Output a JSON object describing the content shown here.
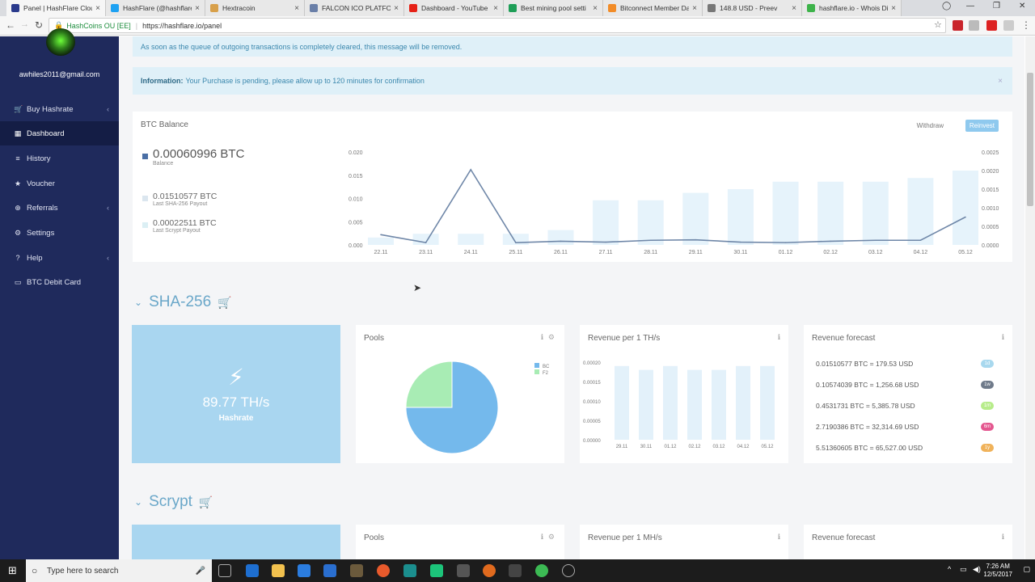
{
  "browser": {
    "tabs": [
      {
        "title": "Panel | HashFlare Clou",
        "color": "#2a3a8c"
      },
      {
        "title": "HashFlare (@hashflare",
        "color": "#1da1f2"
      },
      {
        "title": "Hextracoin",
        "color": "#d8a04a"
      },
      {
        "title": "FALCON ICO PLATFOR",
        "color": "#6a7fa8"
      },
      {
        "title": "Dashboard - YouTube",
        "color": "#e62117"
      },
      {
        "title": "Best mining pool setti",
        "color": "#1e9e57"
      },
      {
        "title": "Bitconnect Member Da",
        "color": "#f28c28"
      },
      {
        "title": "148.8 USD - Preev",
        "color": "#777777"
      },
      {
        "title": "hashflare.io - Whois Di",
        "color": "#3db34a"
      }
    ],
    "site_label": "HashCoins OU [EE]",
    "url": "https://hashflare.io/panel"
  },
  "sidebar": {
    "email": "awhiles2011@gmail.com",
    "items": [
      {
        "label": "Buy Hashrate",
        "icon": "cart-icon",
        "glyph": "🛒",
        "caret": "‹"
      },
      {
        "label": "Dashboard",
        "icon": "dashboard-icon",
        "glyph": "▦",
        "caret": ""
      },
      {
        "label": "History",
        "icon": "history-icon",
        "glyph": "≡",
        "caret": ""
      },
      {
        "label": "Voucher",
        "icon": "star-icon",
        "glyph": "★",
        "caret": ""
      },
      {
        "label": "Referrals",
        "icon": "referrals-icon",
        "glyph": "⊕",
        "caret": "‹"
      },
      {
        "label": "Settings",
        "icon": "gear-icon",
        "glyph": "⚙",
        "caret": ""
      },
      {
        "label": "Help",
        "icon": "help-icon",
        "glyph": "?",
        "caret": "‹"
      },
      {
        "label": "BTC Debit Card",
        "icon": "card-icon",
        "glyph": "▭",
        "caret": ""
      }
    ]
  },
  "alerts": {
    "queue_msg": "As soon as the queue of outgoing transactions is completely cleared, this message will be removed.",
    "info_label": "Information:",
    "info_msg": "Your Purchase is pending, please allow up to 120 minutes for confirmation"
  },
  "btc_balance": {
    "title": "BTC Balance",
    "withdraw": "Withdraw",
    "reinvest": "Reinvest",
    "balance": "0.00060996 BTC",
    "balance_label": "Balance",
    "sha_payout": "0.01510577 BTC",
    "sha_payout_label": "Last SHA-256 Payout",
    "scrypt_payout": "0.00022511 BTC",
    "scrypt_payout_label": "Last Scrypt Payout"
  },
  "sha256": {
    "heading": "SHA-256",
    "hashrate": "89.77 TH/s",
    "hashrate_label": "Hashrate",
    "pools_title": "Pools",
    "revenue_title": "Revenue per 1 TH/s",
    "forecast_title": "Revenue forecast",
    "forecast": [
      {
        "text": "0.01510577 BTC = 179.53 USD",
        "badge": "1d",
        "color": "#a8d8ee"
      },
      {
        "text": "0.10574039 BTC = 1,256.68 USD",
        "badge": "1w",
        "color": "#6f7a8a"
      },
      {
        "text": "0.4531731 BTC = 5,385.78 USD",
        "badge": "1m",
        "color": "#b7ec8a"
      },
      {
        "text": "2.7190386 BTC = 32,314.69 USD",
        "badge": "6m",
        "color": "#e4578f"
      },
      {
        "text": "5.51360605 BTC = 65,527.00 USD",
        "badge": "1y",
        "color": "#f0b25a"
      }
    ]
  },
  "scrypt": {
    "heading": "Scrypt",
    "pools_title": "Pools",
    "revenue_title": "Revenue per 1 MH/s",
    "forecast_title": "Revenue forecast"
  },
  "taskbar": {
    "search_placeholder": "Type here to search",
    "time": "7:26 AM",
    "date": "12/5/2017"
  },
  "chart_data": [
    {
      "type": "line",
      "categories": [
        "22.11",
        "23.11",
        "24.11",
        "25.11",
        "26.11",
        "27.11",
        "28.11",
        "29.11",
        "30.11",
        "01.12",
        "02.12",
        "03.12",
        "04.12",
        "05.12"
      ],
      "series": [
        {
          "values": [
            0.0022,
            0.0005,
            0.0162,
            0.0005,
            0.0008,
            0.0006,
            0.001,
            0.0011,
            0.0006,
            0.0005,
            0.0008,
            0.001,
            0.001,
            0.006
          ]
        }
      ],
      "bars": [
        0.0002,
        0.0003,
        0.0003,
        0.0003,
        0.0004,
        0.0012,
        0.0012,
        0.0014,
        0.0015,
        0.0017,
        0.0017,
        0.0017,
        0.0018,
        0.002
      ],
      "ylim": [
        0,
        0.02
      ],
      "y2lim": [
        0,
        0.0025
      ],
      "yticks": [
        "0.020",
        "0.015",
        "0.010",
        "0.005",
        "0.000"
      ],
      "y2ticks": [
        "0.0025",
        "0.0020",
        "0.0015",
        "0.0010",
        "0.0005",
        "0.0000"
      ]
    },
    {
      "type": "pie",
      "legend": [
        "BC",
        "F2"
      ],
      "values": [
        75,
        25
      ],
      "colors": [
        "#74b9ec",
        "#a8ecb4"
      ]
    },
    {
      "type": "bar",
      "categories": [
        "29.11",
        "30.11",
        "01.12",
        "02.12",
        "03.12",
        "04.12",
        "05.12"
      ],
      "values": [
        0.00019,
        0.00018,
        0.00019,
        0.00018,
        0.00018,
        0.00019,
        0.00019
      ],
      "ylim": [
        0,
        0.0002
      ],
      "yticks": [
        "0.00020",
        "0.00015",
        "0.00010",
        "0.00005",
        "0.00000"
      ]
    }
  ]
}
